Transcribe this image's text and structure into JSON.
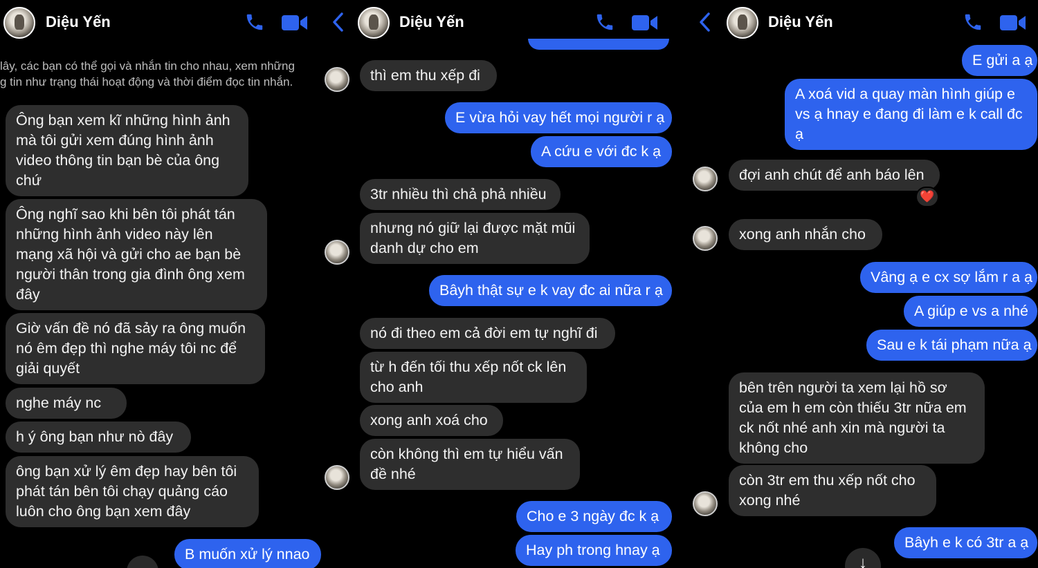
{
  "contact_name": "Diệu Yến",
  "panel1": {
    "notice_lines": [
      "lây, các bạn có thể gọi và nhắn tin cho nhau, xem những",
      "g tin như trạng thái hoạt động và thời điểm đọc tin nhắn."
    ],
    "messages": [
      {
        "dir": "in",
        "lines": [
          "Ông bạn xem kĩ những hình ảnh",
          "mà tôi gửi xem đúng hình ảnh",
          "video thông tin bạn bè của ông",
          "chứ"
        ]
      },
      {
        "dir": "in",
        "lines": [
          "Ông nghĩ sao khi bên tôi phát tán",
          "những hình ảnh video này lên",
          "mạng xã hội và gửi cho ae bạn bè",
          "người thân trong gia đình ông xem",
          "đây"
        ]
      },
      {
        "dir": "in",
        "lines": [
          "Giờ vấn đề nó đã sảy ra ông muốn",
          "nó êm đẹp thì nghe máy tôi nc để",
          "giải quyết"
        ]
      },
      {
        "dir": "in",
        "lines": [
          " nghe máy nc"
        ]
      },
      {
        "dir": "in",
        "lines": [
          "h ý ông bạn như nò đây"
        ]
      },
      {
        "dir": "in",
        "lines": [
          "ông bạn xử lý êm đẹp hay bên tôi",
          "phát tán bên tôi chạy quảng cáo",
          "luôn cho ông bạn xem đây"
        ]
      },
      {
        "dir": "out",
        "lines": [
          "B muốn xử lý nnao"
        ]
      }
    ]
  },
  "panel2": {
    "messages": [
      {
        "dir": "in",
        "lines": [
          "thì em thu xếp đi"
        ]
      },
      {
        "dir": "out",
        "lines": [
          "E vừa hỏi vay hết mọi người r ạ"
        ]
      },
      {
        "dir": "out",
        "lines": [
          "A cứu e với đc k ạ"
        ]
      },
      {
        "dir": "in",
        "lines": [
          "3tr nhiều thì chả phả nhiều"
        ]
      },
      {
        "dir": "in",
        "lines": [
          "nhưng nó giữ lại được mặt mũi",
          "danh dự cho em"
        ]
      },
      {
        "dir": "out",
        "lines": [
          "Bâyh thật sự e k vay đc ai nữa r ạ"
        ]
      },
      {
        "dir": "in",
        "lines": [
          "nó đi theo em cả đời em tự nghĩ đi"
        ]
      },
      {
        "dir": "in",
        "lines": [
          "từ h đến tối thu xếp nốt ck lên",
          "cho anh"
        ]
      },
      {
        "dir": "in",
        "lines": [
          "xong anh xoá cho"
        ]
      },
      {
        "dir": "in",
        "lines": [
          "còn không thì em tự hiểu vấn",
          "đề nhé"
        ]
      },
      {
        "dir": "out",
        "lines": [
          "Cho e 3 ngày đc k ạ"
        ]
      },
      {
        "dir": "out",
        "lines": [
          "Hay ph trong hnay ạ"
        ]
      }
    ]
  },
  "panel3": {
    "messages": [
      {
        "dir": "out",
        "lines": [
          "E gửi a ạ"
        ]
      },
      {
        "dir": "out",
        "lines": [
          "A xoá vid a quay màn hình giúp e",
          "vs ạ hnay e đang đi làm e k call đc",
          "ạ"
        ]
      },
      {
        "dir": "in",
        "lines": [
          "đợi anh chút để anh báo lên"
        ]
      },
      {
        "dir": "in",
        "lines": [
          "xong anh nhắn cho"
        ]
      },
      {
        "dir": "out",
        "lines": [
          "Vâng ạ e cx sợ lắm r a ạ"
        ]
      },
      {
        "dir": "out",
        "lines": [
          "A giúp e vs a nhé"
        ]
      },
      {
        "dir": "out",
        "lines": [
          "Sau e k tái phạm nữa ạ"
        ]
      },
      {
        "dir": "in",
        "lines": [
          " bên trên người ta xem lại hồ sơ",
          "của em h em còn thiếu 3tr nữa em",
          "ck nốt nhé anh xin mà người ta",
          "không cho"
        ]
      },
      {
        "dir": "in",
        "lines": [
          "còn 3tr em thu xếp nốt cho",
          "xong nhé"
        ]
      },
      {
        "dir": "out",
        "lines": [
          "Bâyh e k có 3tr a ạ"
        ]
      }
    ],
    "reaction": "❤️"
  },
  "icons": {
    "phone": "phone-icon",
    "video": "video-camera-icon",
    "back": "chevron-left-icon",
    "scroll": "arrow-down-icon"
  },
  "colors": {
    "accent": "#2e63ee",
    "incoming": "#2e2e2e",
    "background": "#000000",
    "heart": "#ff3040"
  }
}
